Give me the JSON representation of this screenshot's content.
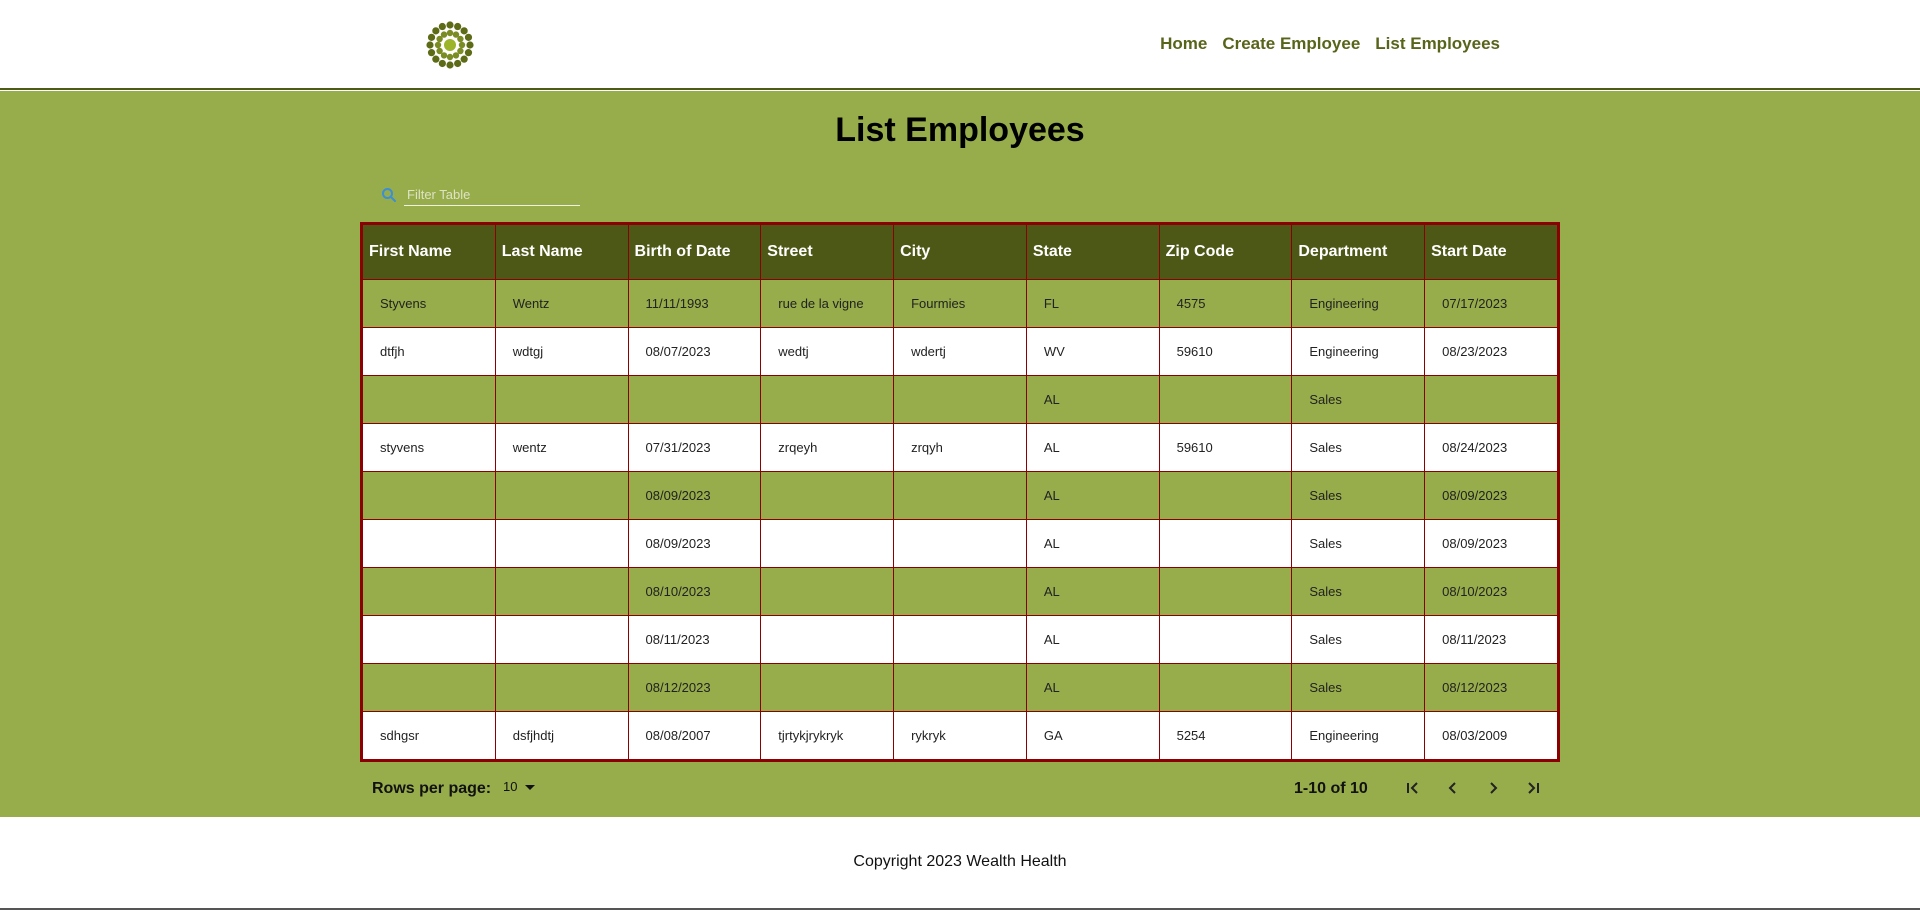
{
  "header": {
    "nav": [
      "Home",
      "Create Employee",
      "List Employees"
    ]
  },
  "main": {
    "title": "List Employees",
    "filter": {
      "placeholder": "Filter Table",
      "value": ""
    },
    "table": {
      "columns": [
        "First Name",
        "Last Name",
        "Birth of Date",
        "Street",
        "City",
        "State",
        "Zip Code",
        "Department",
        "Start Date"
      ],
      "rows": [
        [
          "Styvens",
          "Wentz",
          "11/11/1993",
          "rue de la vigne",
          "Fourmies",
          "FL",
          "4575",
          "Engineering",
          "07/17/2023"
        ],
        [
          "dtfjh",
          "wdtgj",
          "08/07/2023",
          "wedtj",
          "wdertj",
          "WV",
          "59610",
          "Engineering",
          "08/23/2023"
        ],
        [
          "",
          "",
          "",
          "",
          "",
          "AL",
          "",
          "Sales",
          ""
        ],
        [
          "styvens",
          "wentz",
          "07/31/2023",
          "zrqeyh",
          "zrqyh",
          "AL",
          "59610",
          "Sales",
          "08/24/2023"
        ],
        [
          "",
          "",
          "08/09/2023",
          "",
          "",
          "AL",
          "",
          "Sales",
          "08/09/2023"
        ],
        [
          "",
          "",
          "08/09/2023",
          "",
          "",
          "AL",
          "",
          "Sales",
          "08/09/2023"
        ],
        [
          "",
          "",
          "08/10/2023",
          "",
          "",
          "AL",
          "",
          "Sales",
          "08/10/2023"
        ],
        [
          "",
          "",
          "08/11/2023",
          "",
          "",
          "AL",
          "",
          "Sales",
          "08/11/2023"
        ],
        [
          "",
          "",
          "08/12/2023",
          "",
          "",
          "AL",
          "",
          "Sales",
          "08/12/2023"
        ],
        [
          "sdhgsr",
          "dsfjhdtj",
          "08/08/2007",
          "tjrtykjrykryk",
          "rykryk",
          "GA",
          "5254",
          "Engineering",
          "08/03/2009"
        ]
      ]
    },
    "pagination": {
      "rows_per_page_label": "Rows per page:",
      "rows_per_page_value": "10",
      "range": "1-10 of 10"
    }
  },
  "footer": {
    "copyright": "Copyright 2023 Wealth Health"
  },
  "colors": {
    "brand_green": "#97ac4a",
    "header_dark_green": "#4d5716",
    "nav_text": "#58641a",
    "table_border": "#8b0000"
  },
  "icons": {
    "logo": "sunburst-logo-icon",
    "filter": "search-icon",
    "rows_dropdown": "caret-down-icon",
    "pager": [
      "first-page-icon",
      "previous-page-icon",
      "next-page-icon",
      "last-page-icon"
    ]
  }
}
